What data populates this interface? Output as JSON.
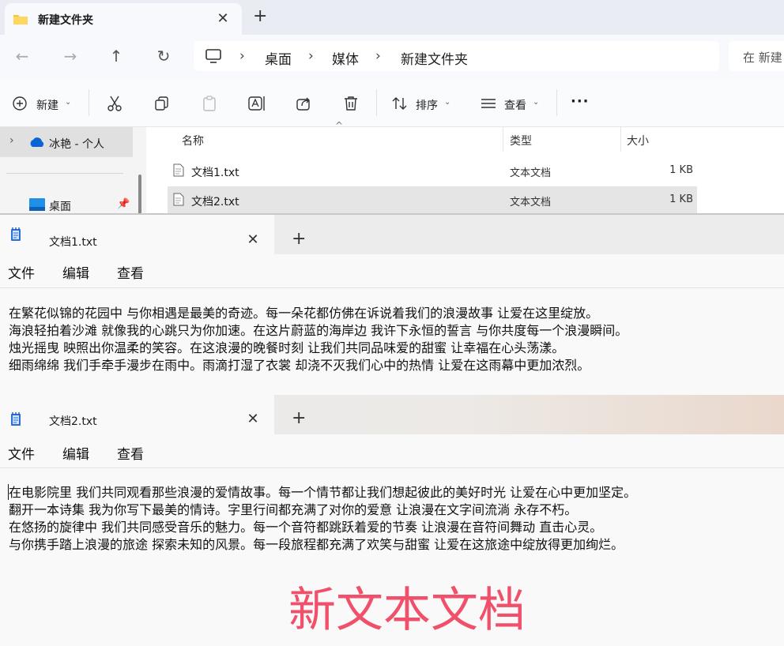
{
  "explorer": {
    "tab_title": "新建文件夹",
    "breadcrumbs": [
      "桌面",
      "媒体",
      "新建文件夹"
    ],
    "search_placeholder": "在 新建",
    "toolbar": {
      "new_label": "新建",
      "sort_label": "排序",
      "view_label": "查看",
      "more_label": "···"
    },
    "sidebar": {
      "cloud_label": "冰艳 - 个人",
      "desktop_label": "桌面"
    },
    "columns": {
      "name": "名称",
      "type": "类型",
      "size": "大小"
    },
    "files": [
      {
        "name": "文档1.txt",
        "type": "文本文档",
        "size": "1 KB"
      },
      {
        "name": "文档2.txt",
        "type": "文本文档",
        "size": "1 KB"
      }
    ]
  },
  "notepad1": {
    "tab_title": "文档1.txt",
    "menu": [
      "文件",
      "编辑",
      "查看"
    ],
    "lines": [
      "在繁花似锦的花园中 与你相遇是最美的奇迹。每一朵花都仿佛在诉说着我们的浪漫故事 让爱在这里绽放。",
      "海浪轻拍着沙滩 就像我的心跳只为你加速。在这片蔚蓝的海岸边 我许下永恒的誓言 与你共度每一个浪漫瞬间。",
      "烛光摇曳 映照出你温柔的笑容。在这浪漫的晚餐时刻 让我们共同品味爱的甜蜜 让幸福在心头荡漾。",
      "细雨绵绵 我们手牵手漫步在雨中。雨滴打湿了衣裳 却浇不灭我们心中的热情 让爱在这雨幕中更加浓烈。"
    ]
  },
  "notepad2": {
    "tab_title": "文档2.txt",
    "menu": [
      "文件",
      "编辑",
      "查看"
    ],
    "lines": [
      "在电影院里 我们共同观看那些浪漫的爱情故事。每一个情节都让我们想起彼此的美好时光 让爱在心中更加坚定。",
      "翻开一本诗集 我为你写下最美的情诗。字里行间都充满了对你的爱意 让浪漫在文字间流淌 永存不朽。",
      "在悠扬的旋律中 我们共同感受音乐的魅力。每一个音符都跳跃着爱的节奏 让浪漫在音符间舞动 直击心灵。",
      "与你携手踏上浪漫的旅途 探索未知的风景。每一段旅程都充满了欢笑与甜蜜 让爱在这旅途中绽放得更加绚烂。"
    ]
  },
  "overlay_title": "新文本文档",
  "colors": {
    "overlay_text": "#f0506a",
    "accent": "#0067c0",
    "selected_row": "#e5e5e5"
  }
}
